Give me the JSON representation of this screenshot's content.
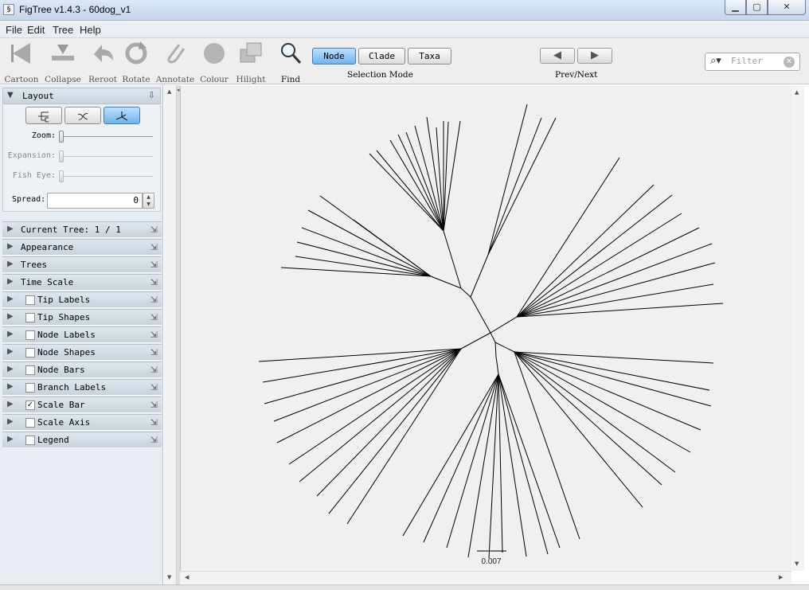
{
  "window": {
    "title": "FigTree v1.4.3 - 60dog_v1",
    "controls": {
      "minimize": "▁",
      "maximize": "▢",
      "close": "✕"
    }
  },
  "menu": [
    "File",
    "Edit",
    "Tree",
    "Help"
  ],
  "toolbar": {
    "tools": [
      {
        "label": "Cartoon",
        "icon": "cartoon-icon",
        "enabled": false
      },
      {
        "label": "Collapse",
        "icon": "collapse-icon",
        "enabled": false
      },
      {
        "label": "Reroot",
        "icon": "reroot-icon",
        "enabled": false
      },
      {
        "label": "Rotate",
        "icon": "rotate-icon",
        "enabled": false
      },
      {
        "label": "Annotate",
        "icon": "annotate-icon",
        "enabled": false
      },
      {
        "label": "Colour",
        "icon": "colour-icon",
        "enabled": false
      },
      {
        "label": "Hilight",
        "icon": "hilight-icon",
        "enabled": false
      },
      {
        "label": "Find",
        "icon": "find-icon",
        "enabled": true
      }
    ],
    "selection_mode": {
      "label": "Selection Mode",
      "options": [
        "Node",
        "Clade",
        "Taxa"
      ],
      "active": "Node"
    },
    "prev_next": {
      "label": "Prev/Next",
      "prev": "◀",
      "next": "▶"
    },
    "filter": {
      "placeholder": "Filter",
      "value": ""
    }
  },
  "left_panel": {
    "layout": {
      "title": "Layout",
      "layout_buttons": [
        {
          "name": "rectangular",
          "icon": "rectangular-layout-icon",
          "glyph": "⊏",
          "active": false
        },
        {
          "name": "polar",
          "icon": "polar-layout-icon",
          "glyph": "⤲",
          "active": false
        },
        {
          "name": "radial",
          "icon": "radial-layout-icon",
          "glyph": "⅄",
          "active": true
        }
      ],
      "sliders": [
        {
          "label": "Zoom:",
          "enabled": true
        },
        {
          "label": "Expansion:",
          "enabled": false
        },
        {
          "label": "Fish Eye:",
          "enabled": false
        }
      ],
      "spread": {
        "label": "Spread:",
        "value": "0"
      }
    },
    "sections": [
      {
        "label": "Current Tree: 1 / 1",
        "has_checkbox": false,
        "checked": false
      },
      {
        "label": "Appearance",
        "has_checkbox": false,
        "checked": false
      },
      {
        "label": "Trees",
        "has_checkbox": false,
        "checked": false
      },
      {
        "label": "Time Scale",
        "has_checkbox": false,
        "checked": false
      },
      {
        "label": "Tip Labels",
        "has_checkbox": true,
        "checked": false
      },
      {
        "label": "Tip Shapes",
        "has_checkbox": true,
        "checked": false
      },
      {
        "label": "Node Labels",
        "has_checkbox": true,
        "checked": false
      },
      {
        "label": "Node Shapes",
        "has_checkbox": true,
        "checked": false
      },
      {
        "label": "Node Bars",
        "has_checkbox": true,
        "checked": false
      },
      {
        "label": "Branch Labels",
        "has_checkbox": true,
        "checked": false
      },
      {
        "label": "Scale Bar",
        "has_checkbox": true,
        "checked": true
      },
      {
        "label": "Scale Axis",
        "has_checkbox": true,
        "checked": false
      },
      {
        "label": "Legend",
        "has_checkbox": true,
        "checked": false
      }
    ]
  },
  "tree": {
    "layout": "radial",
    "scale_bar_label": "0.007",
    "line_color": "#000000",
    "background": "#f0f0f0"
  }
}
